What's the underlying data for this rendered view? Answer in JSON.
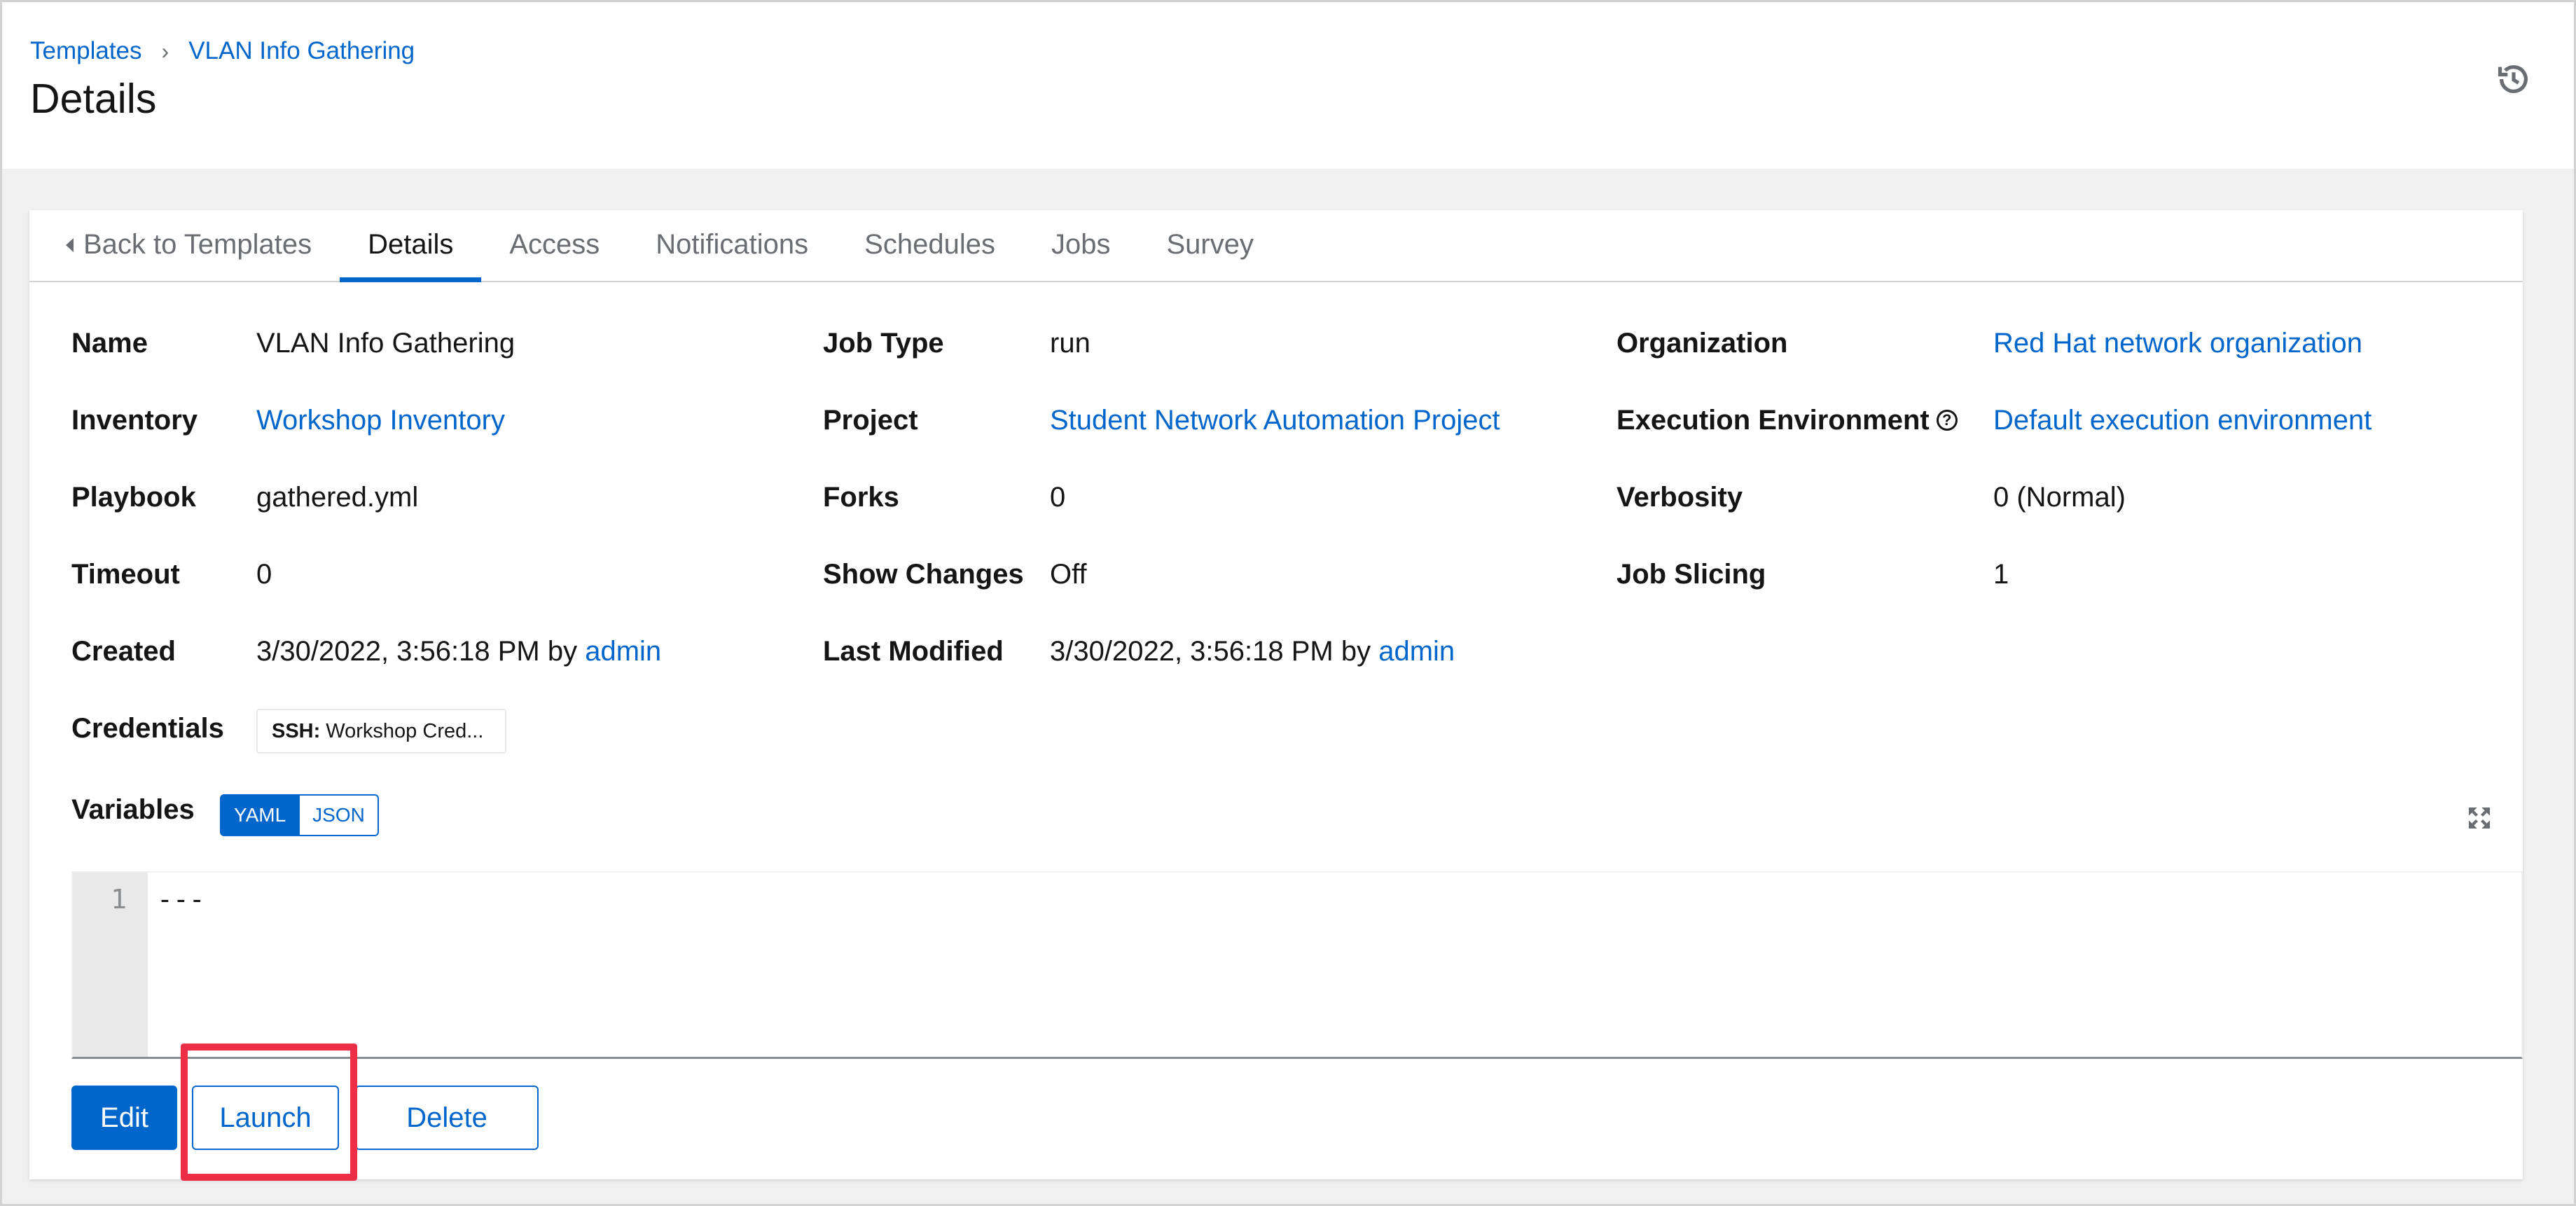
{
  "breadcrumb": {
    "root": "Templates",
    "current": "VLAN Info Gathering"
  },
  "header": {
    "title": "Details"
  },
  "tabs": [
    "Back to Templates",
    "Details",
    "Access",
    "Notifications",
    "Schedules",
    "Jobs",
    "Survey"
  ],
  "details": {
    "name_label": "Name",
    "name_value": "VLAN Info Gathering",
    "job_type_label": "Job Type",
    "job_type_value": "run",
    "organization_label": "Organization",
    "organization_value": "Red Hat network organization",
    "inventory_label": "Inventory",
    "inventory_value": "Workshop Inventory",
    "project_label": "Project",
    "project_value": "Student Network Automation Project",
    "ee_label": "Execution Environment",
    "ee_help": "?",
    "ee_value": "Default execution environment",
    "playbook_label": "Playbook",
    "playbook_value": "gathered.yml",
    "forks_label": "Forks",
    "forks_value": "0",
    "verbosity_label": "Verbosity",
    "verbosity_value": "0 (Normal)",
    "timeout_label": "Timeout",
    "timeout_value": "0",
    "show_changes_label": "Show Changes",
    "show_changes_value": "Off",
    "job_slicing_label": "Job Slicing",
    "job_slicing_value": "1",
    "created_label": "Created",
    "created_value": "3/30/2022, 3:56:18 PM by",
    "created_by": "admin",
    "modified_label": "Last Modified",
    "modified_value": "3/30/2022, 3:56:18 PM by",
    "modified_by": "admin",
    "credentials_label": "Credentials",
    "credential_type": "SSH:",
    "credential_name": "Workshop Cred..."
  },
  "variables": {
    "label": "Variables",
    "format_options": [
      "YAML",
      "JSON"
    ],
    "selected_format": "YAML",
    "line_number": "1",
    "content": "---"
  },
  "actions": {
    "edit": "Edit",
    "launch": "Launch",
    "delete": "Delete"
  },
  "colors": {
    "link": "#0066cc",
    "highlight": "#ee2e46"
  },
  "icons": [
    "history-icon",
    "caret-left-icon",
    "chevron-right-icon",
    "help-icon",
    "expand-icon"
  ]
}
